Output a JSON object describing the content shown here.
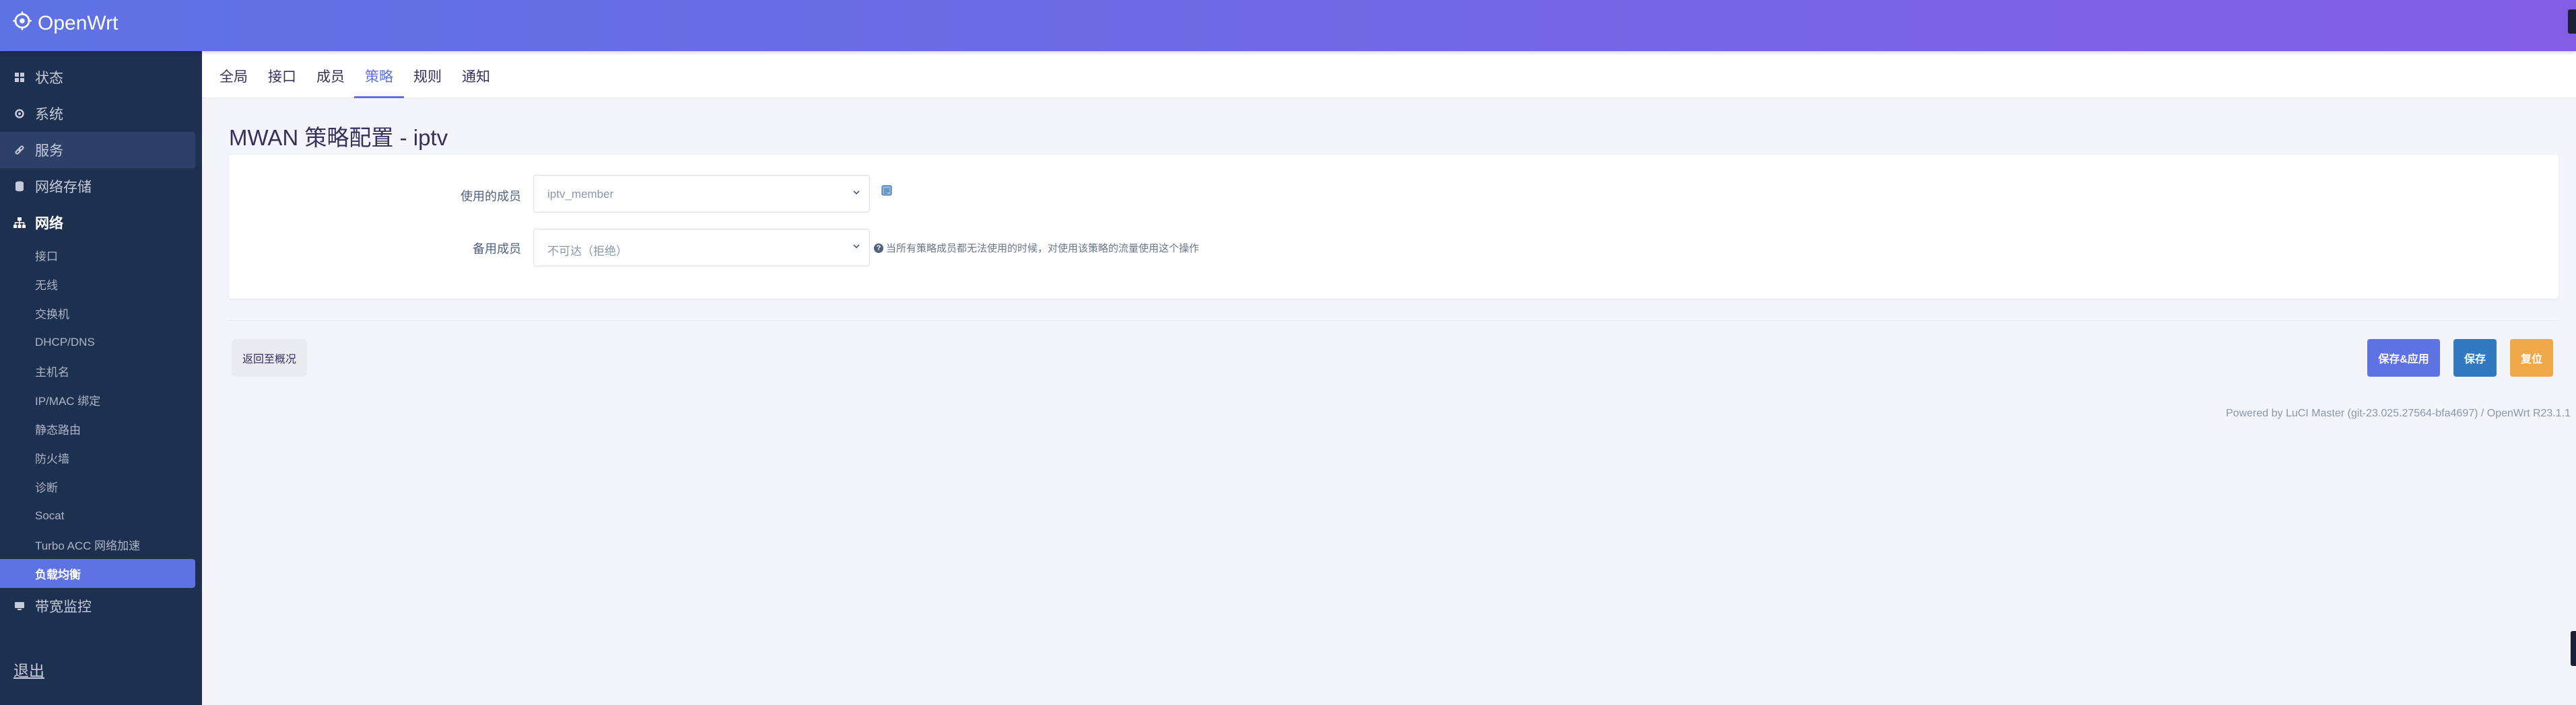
{
  "brand": {
    "name": "OpenWrt"
  },
  "sidebar": {
    "top_items": [
      {
        "label": "状态",
        "icon": "dashboard-icon"
      },
      {
        "label": "系统",
        "icon": "gear-icon"
      },
      {
        "label": "服务",
        "icon": "link-icon"
      },
      {
        "label": "网络存储",
        "icon": "storage-icon"
      },
      {
        "label": "网络",
        "icon": "network-icon"
      }
    ],
    "network_items": [
      {
        "label": "接口"
      },
      {
        "label": "无线"
      },
      {
        "label": "交换机"
      },
      {
        "label": "DHCP/DNS"
      },
      {
        "label": "主机名"
      },
      {
        "label": "IP/MAC 绑定"
      },
      {
        "label": "静态路由"
      },
      {
        "label": "防火墙"
      },
      {
        "label": "诊断"
      },
      {
        "label": "Socat"
      },
      {
        "label": "Turbo ACC 网络加速"
      },
      {
        "label": "负载均衡"
      }
    ],
    "bandwidth_item": {
      "label": "带宽监控",
      "icon": "monitor-icon"
    },
    "logout_label": "退出"
  },
  "tabs": [
    {
      "label": "全局"
    },
    {
      "label": "接口"
    },
    {
      "label": "成员"
    },
    {
      "label": "策略",
      "active": true
    },
    {
      "label": "规则"
    },
    {
      "label": "通知"
    }
  ],
  "page": {
    "title": "MWAN 策略配置 - iptv"
  },
  "form": {
    "member_label": "使用的成员",
    "member_value": "iptv_member",
    "backup_label": "备用成员",
    "backup_value": "不可达（拒绝）",
    "backup_hint": "当所有策略成员都无法使用的时候，对使用该策略的流量使用这个操作"
  },
  "actions": {
    "back_label": "返回至概况",
    "save_apply_label": "保存&应用",
    "save_label": "保存",
    "reset_label": "复位"
  },
  "footer": {
    "text": "Powered by LuCI Master (git-23.025.27564-bfa4697) / OpenWrt R23.1.1"
  },
  "colors": {
    "accent": "#5e72e4",
    "sidebar_bg": "#1e3050",
    "save_blue": "#3379c2",
    "reset_orange": "#f0a94a"
  }
}
